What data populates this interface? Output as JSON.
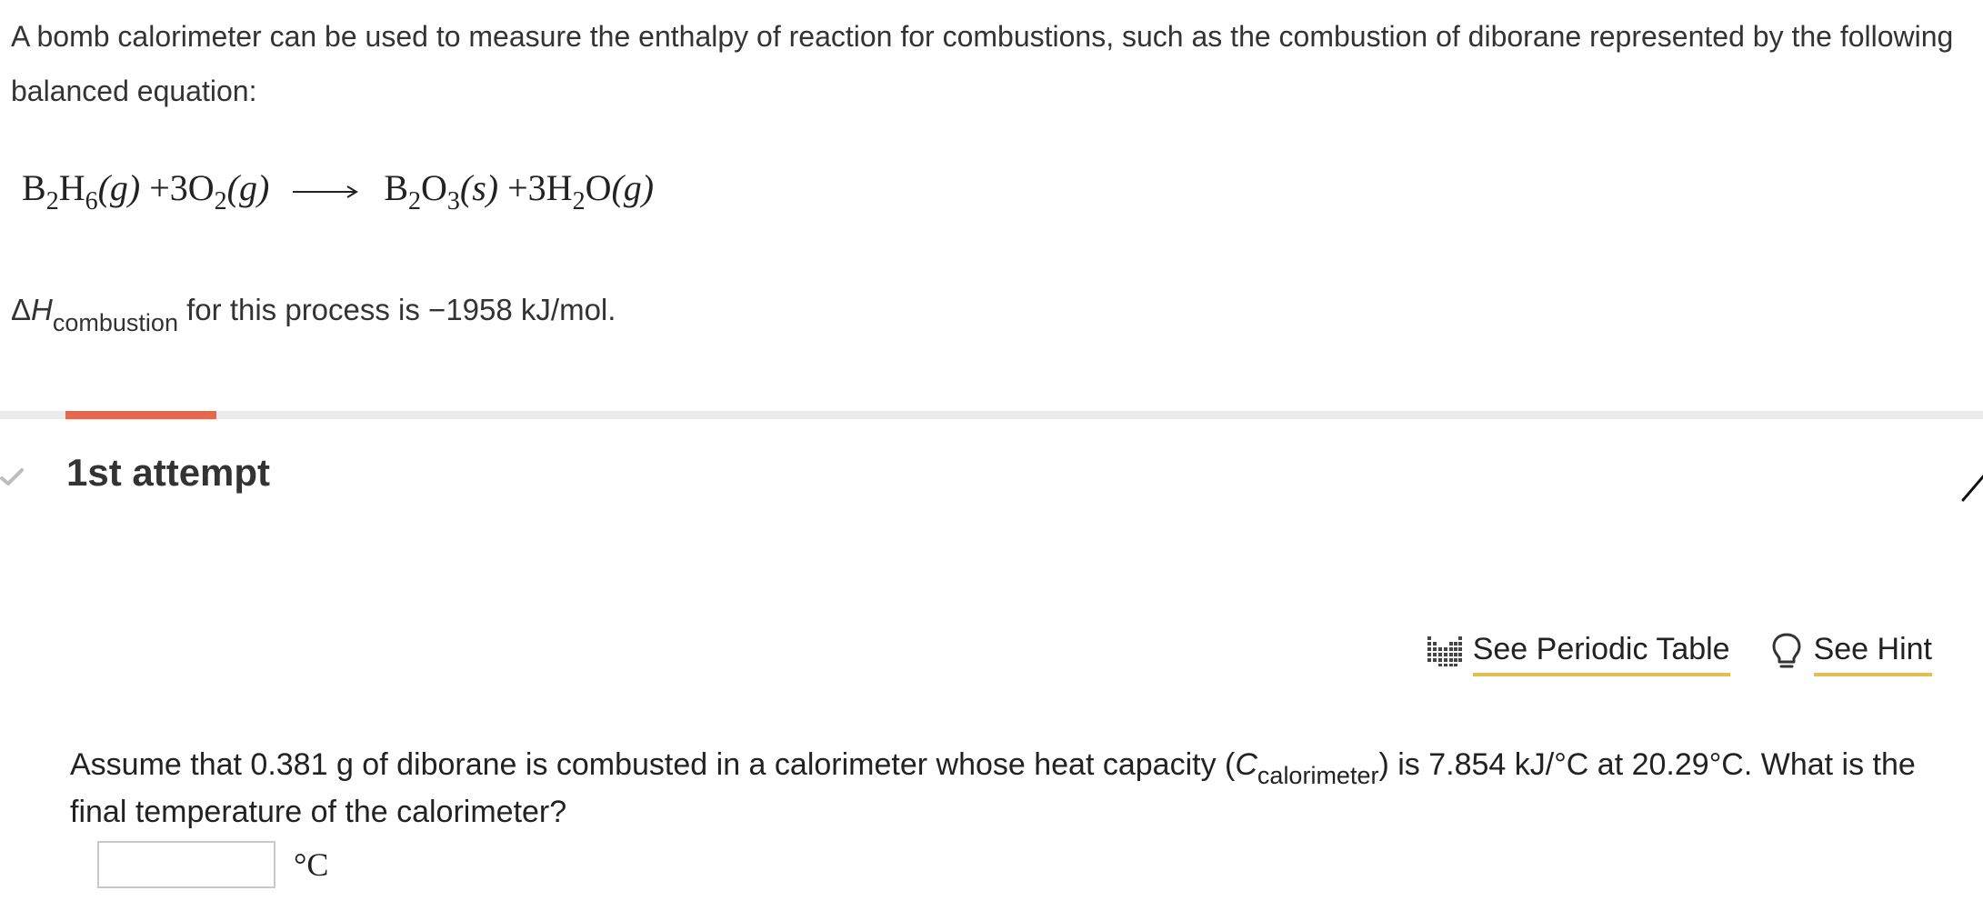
{
  "intro_text": "A bomb calorimeter can be used to measure the enthalpy of reaction for combustions, such as the combustion of diborane represented by the following balanced equation:",
  "equation": {
    "r1_el1": "B",
    "r1_sub1": "2",
    "r1_el2": "H",
    "r1_sub2": "6",
    "r1_state": "(g)",
    "plus1": "+",
    "r2_coef": "3O",
    "r2_sub": "2",
    "r2_state": "(g)",
    "p1_el1": "B",
    "p1_sub1": "2",
    "p1_el2": "O",
    "p1_sub2": "3",
    "p1_state": "(s)",
    "plus2": "+",
    "p2_coef": "3H",
    "p2_sub": "2",
    "p2_el": "O",
    "p2_state": "(g)"
  },
  "enthalpy": {
    "symbol_delta": "Δ",
    "symbol_h": "H",
    "subscript": "combustion",
    "text": " for this process is −1958 kJ/mol."
  },
  "progress": {
    "fraction": 0.076,
    "fill_color": "#e0694e",
    "track_color": "#ebebeb"
  },
  "attempt": {
    "title": "1st attempt",
    "status_icon": "check-icon",
    "edit_icon": "pencil-icon"
  },
  "tools": {
    "periodic_table_label": "See Periodic Table",
    "periodic_table_icon": "periodic-table-icon",
    "hint_label": "See Hint",
    "hint_icon": "lightbulb-icon",
    "underline_color": "#e6bd52"
  },
  "question": {
    "part1": "Assume that 0.381 g of diborane is combusted in a calorimeter whose heat capacity (",
    "c_symbol": "C",
    "c_subscript": "calorimeter",
    "part2": ") is 7.854 kJ/°C at 20.29°C. What is the final temperature of the calorimeter?"
  },
  "answer": {
    "value": "",
    "unit": "°C"
  }
}
